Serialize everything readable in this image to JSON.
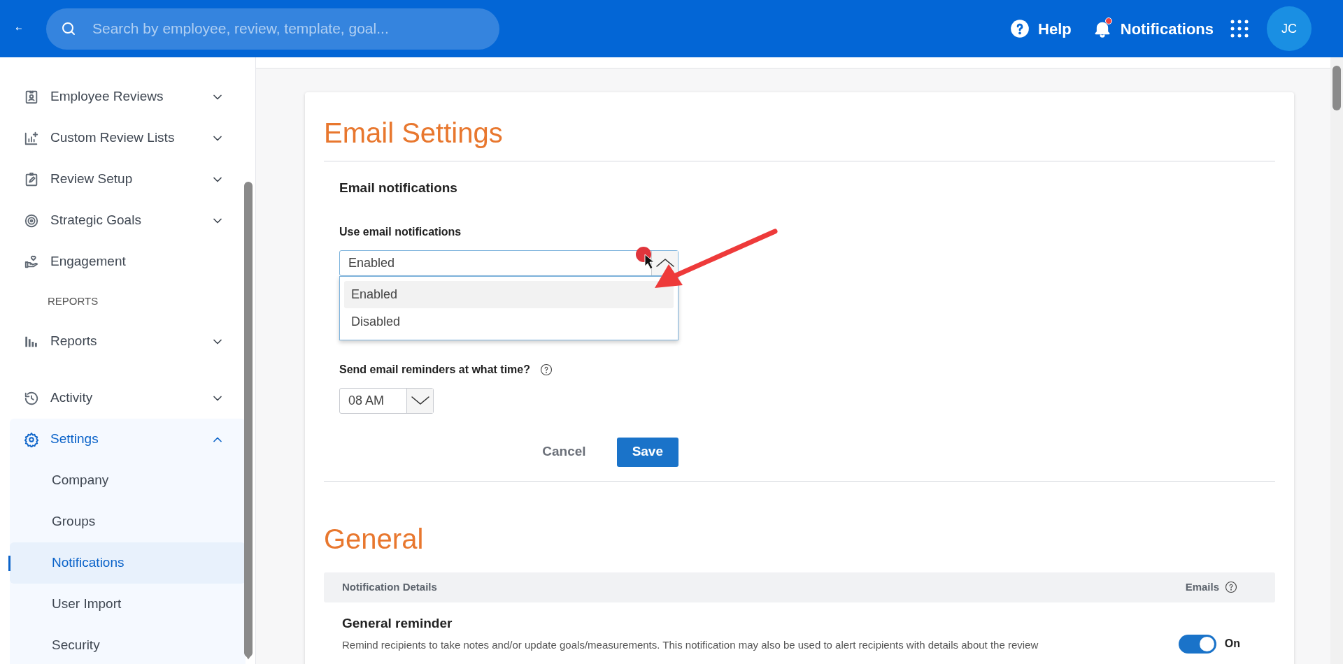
{
  "topbar": {
    "search_placeholder": "Search by employee, review, template, goal...",
    "help": "Help",
    "notifications": "Notifications",
    "has_unread": true,
    "avatar": "JC"
  },
  "sidebar": {
    "items": [
      {
        "kind": "item",
        "label": "Employee Reviews",
        "expanded": false
      },
      {
        "kind": "item",
        "label": "Custom Review Lists",
        "expanded": false
      },
      {
        "kind": "item",
        "label": "Review Setup",
        "expanded": false
      },
      {
        "kind": "item",
        "label": "Strategic Goals",
        "expanded": false
      },
      {
        "kind": "item",
        "label": "Engagement"
      },
      {
        "kind": "heading",
        "label": "REPORTS"
      },
      {
        "kind": "item",
        "label": "Reports",
        "expanded": false
      },
      {
        "kind": "gap"
      },
      {
        "kind": "item",
        "label": "Activity",
        "expanded": false
      },
      {
        "kind": "item",
        "label": "Settings",
        "expanded": true,
        "children": [
          {
            "label": "Company",
            "selected": false
          },
          {
            "label": "Groups",
            "selected": false
          },
          {
            "label": "Notifications",
            "selected": true
          },
          {
            "label": "User Import",
            "selected": false
          },
          {
            "label": "Security",
            "selected": false
          }
        ]
      }
    ]
  },
  "email_settings": {
    "title": "Email Settings",
    "section_title": "Email notifications",
    "use_email": {
      "label": "Use email notifications",
      "value": "Enabled",
      "open": true,
      "options": [
        {
          "label": "Enabled",
          "selected": true
        },
        {
          "label": "Disabled",
          "selected": false
        }
      ]
    },
    "reminder_time": {
      "label": "Send email reminders at what time?",
      "value": "08 AM",
      "open": false
    },
    "buttons": [
      {
        "kind": "secondary",
        "label": "Cancel"
      },
      {
        "kind": "primary",
        "label": "Save"
      }
    ]
  },
  "general": {
    "title": "General",
    "columns": [
      "Notification Details",
      "Emails"
    ],
    "rows": [
      {
        "title": "General reminder",
        "description": "Remind recipients to take notes and/or update goals/measurements. This notification may also be used to alert recipients with details about the review",
        "on": true,
        "state_label": "On"
      }
    ]
  }
}
